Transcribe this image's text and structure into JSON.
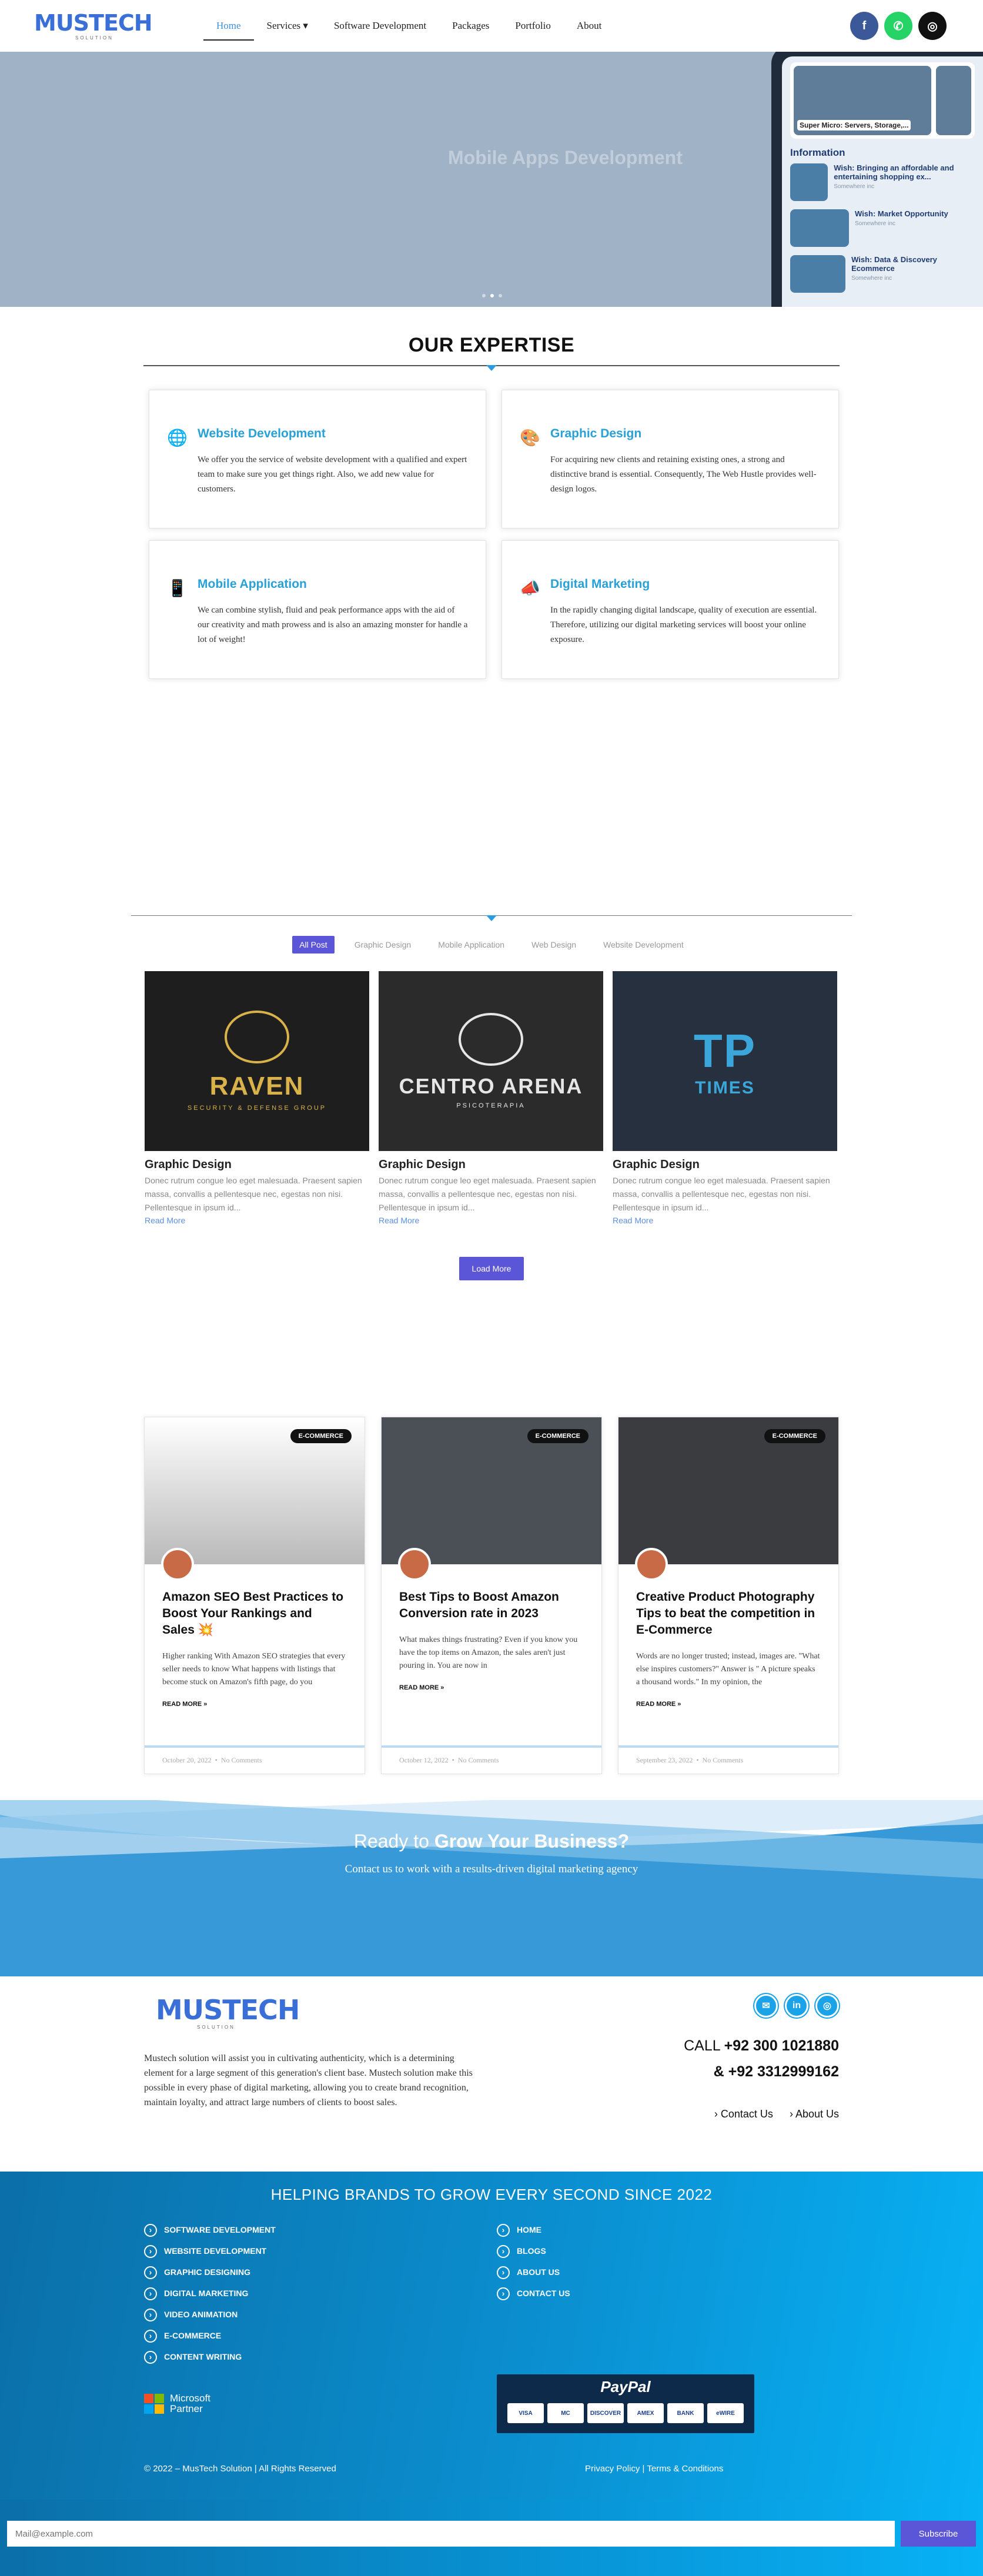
{
  "header": {
    "logo_text": "MUSTECH",
    "logo_sub": "SOLUTION",
    "nav": [
      "Home",
      "Services",
      "Software Development",
      "Packages",
      "Portfolio",
      "About"
    ],
    "socials": [
      "facebook-icon",
      "whatsapp-icon",
      "instagram-icon"
    ]
  },
  "hero": {
    "title": "Mobile Apps Development",
    "phone_card_caption": "Super Micro: Servers, Storage,...",
    "phone_heading": "Information",
    "phone_items": [
      {
        "title": "Wish: Bringing an affordable and entertaining shopping ex...",
        "sub": "Somewhere inc"
      },
      {
        "title": "Wish: Market Opportunity",
        "sub": "Somewhere inc"
      },
      {
        "title": "Wish: Data & Discovery Ecommerce",
        "sub": "Somewhere inc"
      }
    ],
    "active_slide": 2,
    "slides": 3
  },
  "expertise": {
    "title": "OUR EXPERTISE",
    "cards": [
      {
        "icon": "globe-icon",
        "title": "Website Development",
        "text": "We offer you the service of website development with a qualified and expert team to make sure you get things right. Also, we add new value for customers."
      },
      {
        "icon": "design-icon",
        "title": "Graphic Design",
        "text": "For acquiring new clients and retaining existing ones, a strong and distinctive brand is essential. Consequently, The Web Hustle provides well-design logos."
      },
      {
        "icon": "mobile-icon",
        "title": "Mobile Application",
        "text": "We can combine stylish, fluid and peak performance apps with the aid of our creativity and math prowess and is also an amazing monster for handle a lot of weight!"
      },
      {
        "icon": "megaphone-icon",
        "title": "Digital Marketing",
        "text": "In the rapidly changing digital landscape, quality of execution are essential. Therefore, utilizing our digital marketing services will boost your online exposure."
      }
    ]
  },
  "portfolio": {
    "filters": [
      "All Post",
      "Graphic Design",
      "Mobile Application",
      "Web Design",
      "Website Development"
    ],
    "items": [
      {
        "brand": "RAVEN",
        "tag": "SECURITY & DEFENSE GROUP",
        "category": "Graphic Design",
        "excerpt": "Donec rutrum congue leo eget malesuada. Praesent sapien massa, convallis a pellentesque nec, egestas non nisi. Pellentesque in ipsum id...",
        "link": "Read More"
      },
      {
        "brand": "CENTRO ARENA",
        "tag": "PSICOTERAPIA",
        "category": "Graphic Design",
        "excerpt": "Donec rutrum congue leo eget malesuada. Praesent sapien massa, convallis a pellentesque nec, egestas non nisi. Pellentesque in ipsum id...",
        "link": "Read More"
      },
      {
        "brand": "TIMES",
        "tag": "TP",
        "category": "Graphic Design",
        "excerpt": "Donec rutrum congue leo eget malesuada. Praesent sapien massa, convallis a pellentesque nec, egestas non nisi. Pellentesque in ipsum id...",
        "link": "Read More"
      }
    ],
    "load_more": "Load More"
  },
  "blog": [
    {
      "badge": "E-COMMERCE",
      "title": "Amazon SEO Best Practices to Boost Your Rankings and Sales 💥",
      "excerpt": "Higher ranking With Amazon SEO strategies that every seller needs to know What happens with listings that become stuck on Amazon's fifth page, do you",
      "more": "READ MORE »",
      "date": "October 20, 2022",
      "comments": "No Comments"
    },
    {
      "badge": "E-COMMERCE",
      "title": "Best Tips to Boost Amazon Conversion rate in 2023",
      "excerpt": "What makes things frustrating? Even if you know you have the top items on Amazon, the sales aren't just pouring in. You are now in",
      "more": "READ MORE »",
      "date": "October 12, 2022",
      "comments": "No Comments"
    },
    {
      "badge": "E-COMMERCE",
      "title": "Creative Product Photography Tips to beat the competition in E-Commerce",
      "excerpt": "Words are no longer trusted; instead, images are. \"What else inspires customers?\" Answer is \" A picture speaks a thousand words.\" In my opinion, the",
      "more": "READ MORE »",
      "date": "September 23, 2022",
      "comments": "No Comments"
    }
  ],
  "cta": {
    "title_light": "Ready to ",
    "title_bold": "Grow Your Business?",
    "subtitle": "Contact us to work with a results-driven digital marketing agency"
  },
  "footer": {
    "about": "Mustech solution will assist you in cultivating authenticity, which is a determining element for a large segment of this generation's client base. Mustech solution make this possible in every phase of digital marketing, allowing you to create brand recognition, maintain loyalty, and attract large numbers of clients to boost sales.",
    "socials": [
      "email-icon",
      "linkedin-icon",
      "instagram-icon"
    ],
    "call_label": "CALL ",
    "phone1": "+92 300 1021880",
    "phone2": "& +92 3312999162",
    "links": [
      "Contact Us",
      "About Us"
    ],
    "tagline": "HELPING BRANDS TO GROW EVERY SECOND SINCE 2022",
    "services": [
      "SOFTWARE DEVELOPMENT",
      "WEBSITE DEVELOPMENT",
      "GRAPHIC DESIGNING",
      "DIGITAL MARKETING",
      "VIDEO ANIMATION",
      "E-COMMERCE",
      "CONTENT WRITING"
    ],
    "pages": [
      "HOME",
      "BLOGS",
      "ABOUT US",
      "CONTACT US"
    ],
    "ms_partner": "Microsoft\nPartner",
    "paypal": "PayPal",
    "cards": [
      "VISA",
      "MC",
      "DISCOVER",
      "AMEX",
      "BANK",
      "eWIRE"
    ],
    "copyright": "© 2022 – MusTech Solution | All Rights Reserved",
    "policy": "Privacy Policy | Terms & Conditions"
  },
  "newsletter": {
    "placeholder": "Mail@example.com",
    "button": "Subscribe"
  },
  "colors": {
    "accent": "#5b55d8",
    "brand_blue": "#28a0d8",
    "footer_blue": "#0b8fd0"
  }
}
